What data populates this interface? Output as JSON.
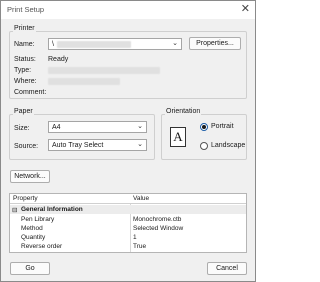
{
  "window": {
    "title": "Print Setup",
    "close_glyph": "✕"
  },
  "printer": {
    "legend": "Printer",
    "name_label": "Name:",
    "name_prefix": "\\",
    "properties_button": "Properties...",
    "status_label": "Status:",
    "status_value": "Ready",
    "type_label": "Type:",
    "where_label": "Where:",
    "comment_label": "Comment:"
  },
  "paper": {
    "legend": "Paper",
    "size_label": "Size:",
    "size_value": "A4",
    "source_label": "Source:",
    "source_value": "Auto Tray Select"
  },
  "orientation": {
    "legend": "Orientation",
    "icon_letter": "A",
    "portrait_label": "Portrait",
    "landscape_label": "Landscape",
    "selected": "Portrait"
  },
  "network_button": "Network...",
  "grid": {
    "col_property": "Property",
    "col_value": "Value",
    "category": "General Information",
    "category_toggle": "⊟",
    "rows": [
      {
        "property": "Pen Library",
        "value": "Monochrome.ctb"
      },
      {
        "property": "Method",
        "value": "Selected Window"
      },
      {
        "property": "Quantity",
        "value": "1"
      },
      {
        "property": "Reverse order",
        "value": "True"
      }
    ]
  },
  "go_button": "Go",
  "cancel_button": "Cancel",
  "icons": {
    "chevron": "chevron-down-icon",
    "close": "close-icon"
  }
}
